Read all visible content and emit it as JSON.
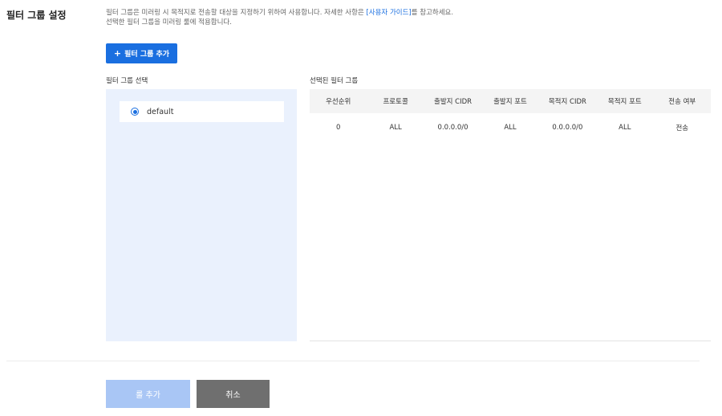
{
  "section": {
    "title": "필터 그룹 설정"
  },
  "description": {
    "line1_before": "필터 그룹은 미러링 시 목적지로 전송할 대상을 지정하기 위하여 사용합니다. 자세한 사항은 ",
    "link": "[사용자 가이드]",
    "line1_after": "를 참고하세요.",
    "line2": "선택한 필터 그룹을 미러링 룰에 적용합니다."
  },
  "add_group_button": {
    "plus": "+",
    "label": "필터 그룹 추가"
  },
  "group_select": {
    "label": "필터 그룹 선택",
    "items": [
      {
        "name": "default",
        "selected": true
      }
    ]
  },
  "selected_groups": {
    "label": "선택된 필터 그룹",
    "columns": [
      "우선순위",
      "프로토콜",
      "출발지 CIDR",
      "출발지 포트",
      "목적지 CIDR",
      "목적지 포트",
      "전송 여부"
    ],
    "rows": [
      [
        "0",
        "ALL",
        "0.0.0.0/0",
        "ALL",
        "0.0.0.0/0",
        "ALL",
        "전송"
      ]
    ]
  },
  "footer": {
    "add_rule_label": "룰 추가",
    "cancel_label": "취소"
  },
  "colors": {
    "accent": "#1a6fe0",
    "panel_bg": "#eaf1fd",
    "disabled_button": "#a9c6f5",
    "cancel_button": "#6f6f6f"
  }
}
